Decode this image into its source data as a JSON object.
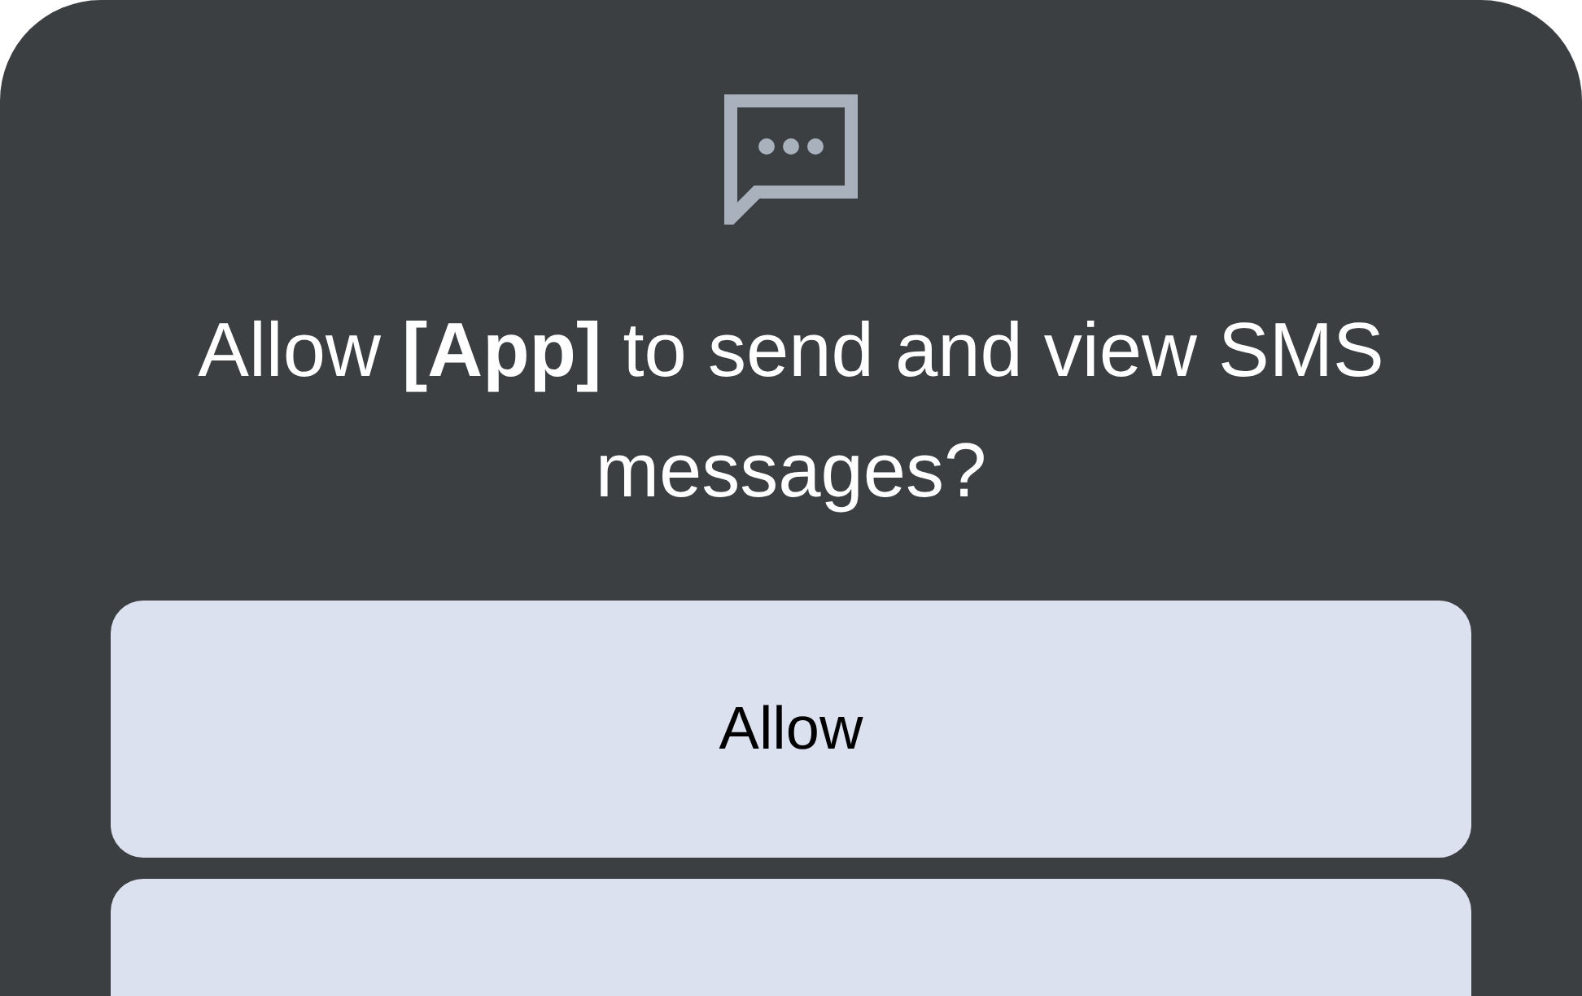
{
  "dialog": {
    "title": "Allow **[App]** to send and view SMS messages?",
    "buttons": [
      {
        "kind": "labeled",
        "label": "Allow"
      },
      {
        "kind": "cut_off"
      }
    ]
  }
}
